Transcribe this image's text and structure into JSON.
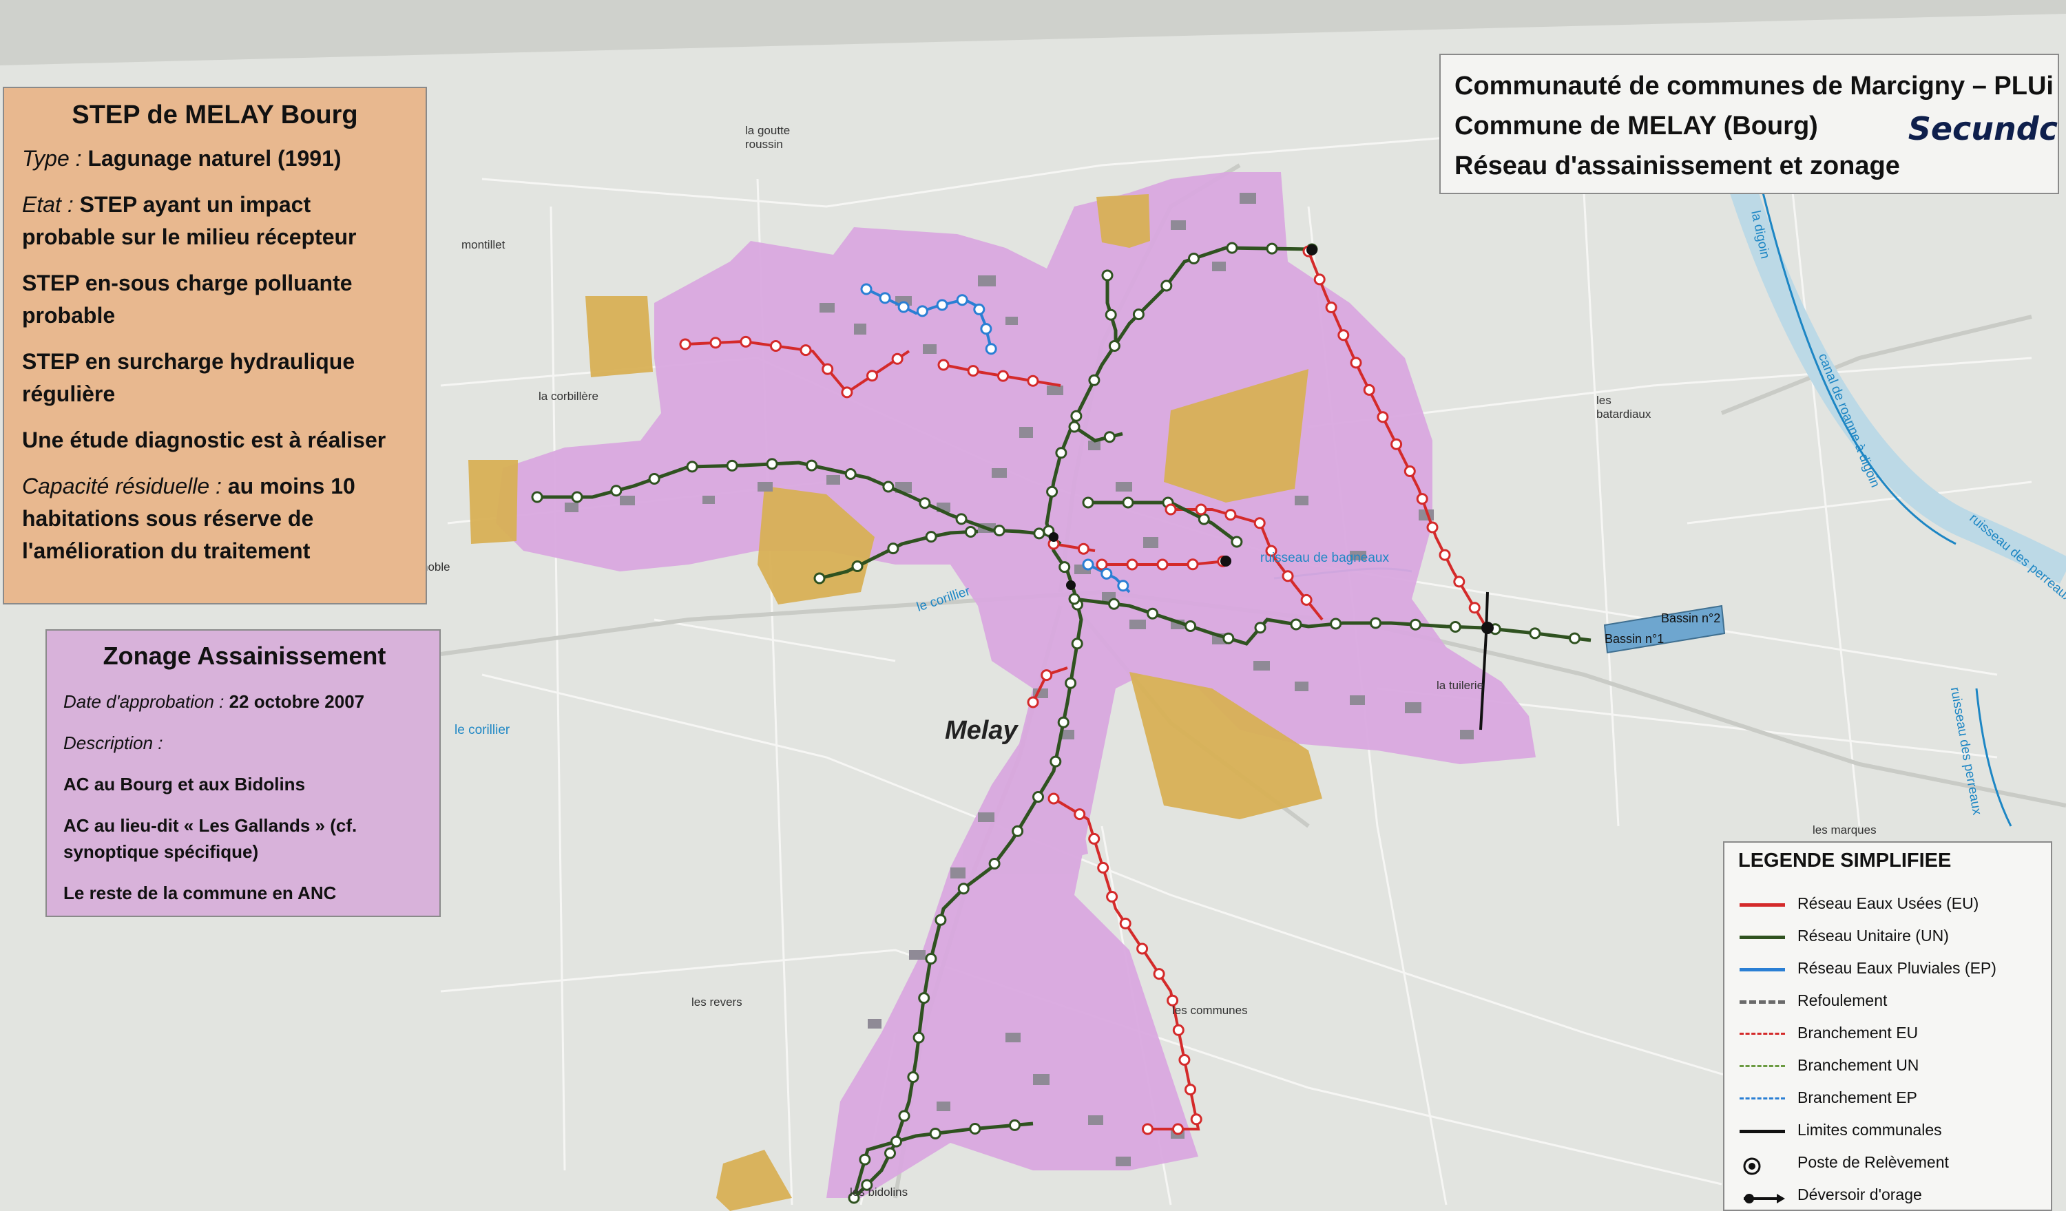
{
  "step": {
    "title": "STEP de MELAY Bourg",
    "type_label": "Type :",
    "type_value": "Lagunage naturel (1991)",
    "etat_label": "Etat :",
    "etat_value": "STEP ayant un impact probable sur le milieu récepteur",
    "sous_charge": "STEP en-sous charge polluante probable",
    "surcharge": "STEP en surcharge hydraulique régulière",
    "etude": "Une étude diagnostic est à réaliser",
    "capacite_label": "Capacité résiduelle :",
    "capacite_value": "au moins 10 habitations sous réserve de l'amélioration du traitement"
  },
  "zonage": {
    "title": "Zonage Assainissement",
    "date_label": "Date d'approbation :",
    "date_value": "22 octobre 2007",
    "description_label": "Description :",
    "items": [
      "AC au Bourg et aux Bidolins",
      "AC au lieu-dit « Les Gallands » (cf. synoptique spécifique)",
      "Le reste de la commune en ANC"
    ]
  },
  "title_block": {
    "line1": "Communauté de communes de Marcigny – PLUi",
    "line2": "Commune de MELAY (Bourg)",
    "line3": "Réseau d'assainissement et zonage",
    "logo": "Secundc"
  },
  "legend": {
    "title": "LEGENDE SIMPLIFIEE",
    "items": [
      {
        "label": "Réseau Eaux Usées (EU)",
        "color": "#d42a2a",
        "style": "solid"
      },
      {
        "label": "Réseau Unitaire (UN)",
        "color": "#2f5220",
        "style": "solid"
      },
      {
        "label": "Réseau Eaux Pluviales (EP)",
        "color": "#2a7fd4",
        "style": "solid"
      },
      {
        "label": "Refoulement",
        "color": "#6a6a6a",
        "style": "dashed"
      },
      {
        "label": "Branchement EU",
        "color": "#d42a2a",
        "style": "dashed"
      },
      {
        "label": "Branchement UN",
        "color": "#6a9a40",
        "style": "dashed"
      },
      {
        "label": "Branchement EP",
        "color": "#2a7fd4",
        "style": "dashed"
      },
      {
        "label": "Limites communales",
        "color": "#111111",
        "style": "solid"
      },
      {
        "label": "Poste de Relèvement",
        "color": "#111111",
        "style": "symbol-pr"
      },
      {
        "label": "Déversoir d'orage",
        "color": "#111111",
        "style": "symbol-do"
      }
    ]
  },
  "places": {
    "town": "Melay",
    "la_goutte_roussin": "la goutte roussin",
    "montillet": "montillet",
    "la_corbillere": "la corbillère",
    "les_batardiaux": "les batardiaux",
    "noble": "noble",
    "la_tuilerie": "la tuilerie",
    "les_revers": "les revers",
    "les_communes": "les communes",
    "les_marques": "les marques",
    "les_bidolins": "les bidolins"
  },
  "streams": {
    "ruisseau_bagneaux": "ruisseau de bagneaux",
    "le_corillier_1": "le corillier",
    "le_corillier_2": "le corillier",
    "la_digoin": "la digoin",
    "canal": "canal de roanne à digoin",
    "ruisseau_perreaux_1": "ruisseau des perreaux",
    "ruisseau_perreaux_2": "ruisseau des perreaux"
  },
  "basins": {
    "bassin1": "Bassin n°1",
    "bassin2": "Bassin n°2"
  },
  "colors": {
    "zone_ac": "#d9a8df",
    "zone_future": "#d8b055",
    "network_eu": "#d42a2a",
    "network_un": "#2f5220",
    "network_ep": "#2a7fd4",
    "basin": "#6ea6cf",
    "panel_step": "#e8b88f",
    "panel_zonage": "#d8b2da"
  }
}
